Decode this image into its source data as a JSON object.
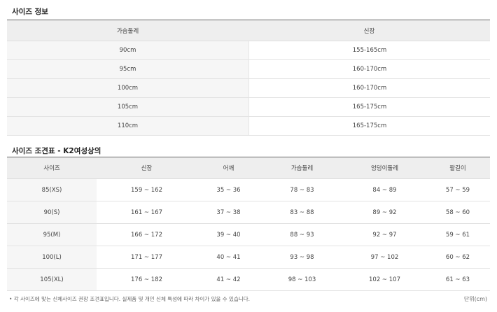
{
  "section1": {
    "title": "사이즈 정보",
    "headers": [
      "가슴둘레",
      "신장"
    ],
    "rows": [
      [
        "90cm",
        "155-165cm"
      ],
      [
        "95cm",
        "160-170cm"
      ],
      [
        "100cm",
        "160-170cm"
      ],
      [
        "105cm",
        "165-175cm"
      ],
      [
        "110cm",
        "165-175cm"
      ]
    ]
  },
  "section2": {
    "title": "사이즈 조견표 - K2여성상의",
    "headers": [
      "사이즈",
      "신장",
      "어깨",
      "가슴둘레",
      "엉덩이둘레",
      "팔길이"
    ],
    "rows": [
      [
        "85(XS)",
        "159 ~ 162",
        "35 ~ 36",
        "78 ~ 83",
        "84 ~ 89",
        "57 ~ 59"
      ],
      [
        "90(S)",
        "161 ~ 167",
        "37 ~ 38",
        "83 ~ 88",
        "89 ~ 92",
        "58 ~ 60"
      ],
      [
        "95(M)",
        "166 ~ 172",
        "39 ~ 40",
        "88 ~ 93",
        "92 ~ 97",
        "59 ~ 61"
      ],
      [
        "100(L)",
        "171 ~ 177",
        "40 ~ 41",
        "93 ~ 98",
        "97 ~ 102",
        "60 ~ 62"
      ],
      [
        "105(XL)",
        "176 ~ 182",
        "41 ~ 42",
        "98 ~ 103",
        "102 ~ 107",
        "61 ~ 63"
      ]
    ]
  },
  "footer": {
    "note": "• 각 사이즈에 맞는 신체사이즈 권장 조견표입니다. 실제품 및 개인 신체 특성에 따라 차이가 있을 수 있습니다.",
    "unit": "단위(cm)"
  }
}
